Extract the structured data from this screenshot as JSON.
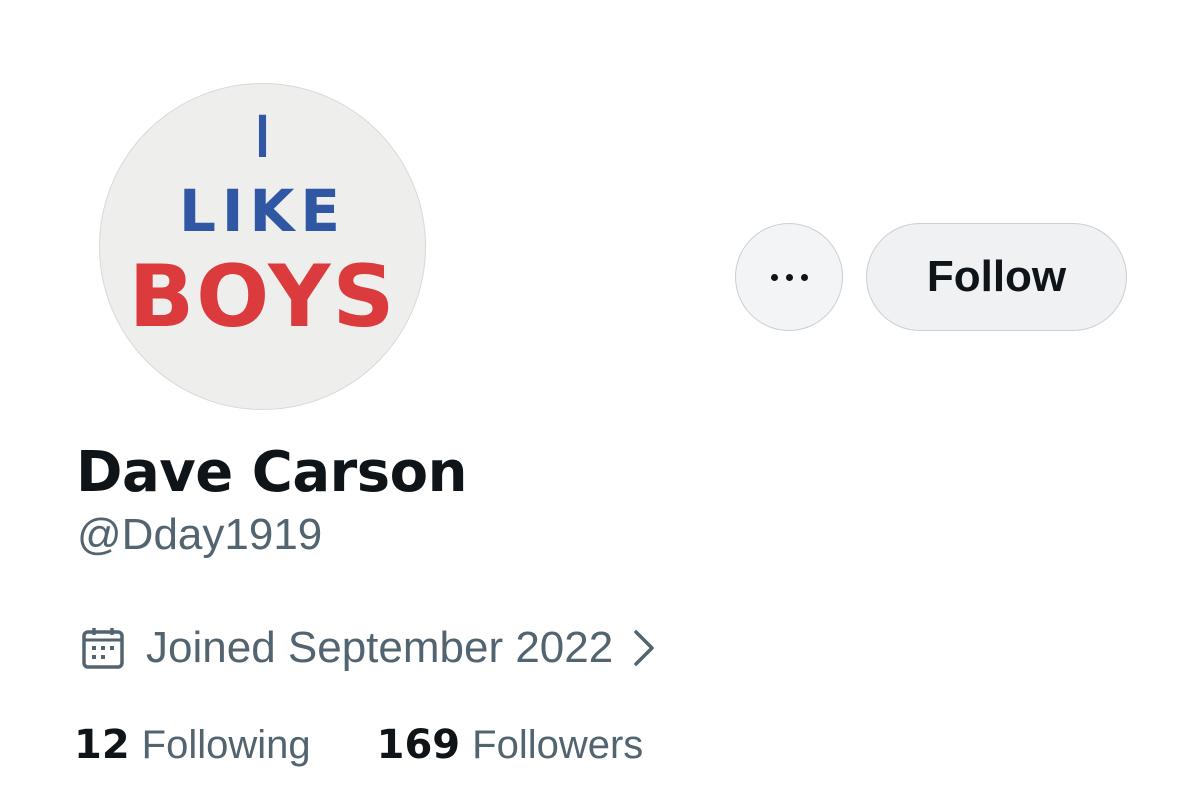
{
  "profile": {
    "avatar": {
      "line1": "I",
      "line2": "LIKE",
      "line3": "BOYS"
    },
    "display_name": "Dave Carson",
    "handle": "@Dday1919",
    "joined": "Joined September 2022"
  },
  "actions": {
    "more_icon": "more-horizontal-icon",
    "follow_label": "Follow"
  },
  "stats": {
    "following_count": "12",
    "following_label": "Following",
    "followers_count": "169",
    "followers_label": "Followers"
  },
  "colors": {
    "text_primary": "#0f1419",
    "text_secondary": "#536471",
    "badge_blue": "#2f57a4",
    "badge_red": "#dc3b3d",
    "button_bg": "#eff1f3",
    "button_border": "#c9cfd5"
  }
}
